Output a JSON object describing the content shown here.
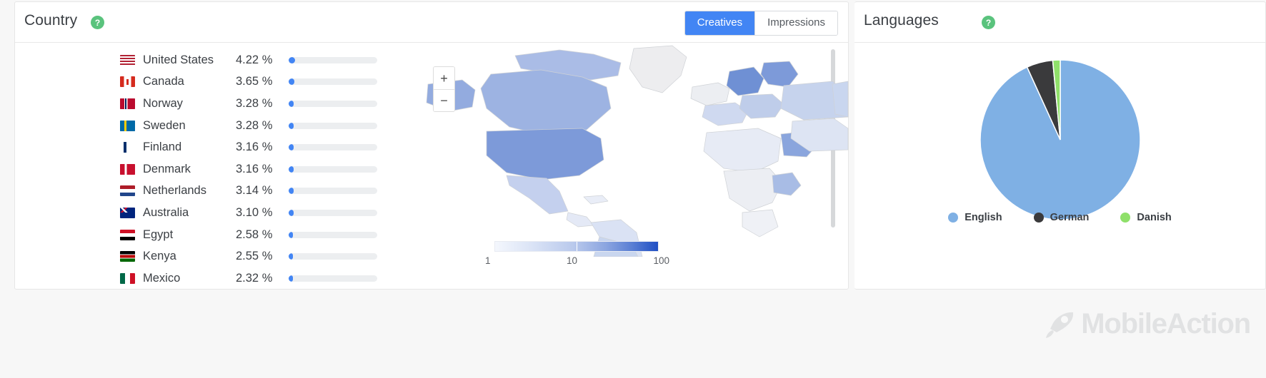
{
  "country_panel": {
    "title": "Country",
    "help_icon": "question-mark-icon",
    "help_label": "?",
    "toggle": {
      "options": [
        "Creatives",
        "Impressions"
      ],
      "selected": "Creatives"
    },
    "columns": [
      "flag",
      "country",
      "percent",
      "share_bar"
    ],
    "rows": [
      {
        "country": "United States",
        "percent": "4.22 %",
        "value": 4.22,
        "flag": "us"
      },
      {
        "country": "Canada",
        "percent": "3.65 %",
        "value": 3.65,
        "flag": "ca"
      },
      {
        "country": "Norway",
        "percent": "3.28 %",
        "value": 3.28,
        "flag": "no"
      },
      {
        "country": "Sweden",
        "percent": "3.28 %",
        "value": 3.28,
        "flag": "se"
      },
      {
        "country": "Finland",
        "percent": "3.16 %",
        "value": 3.16,
        "flag": "fi"
      },
      {
        "country": "Denmark",
        "percent": "3.16 %",
        "value": 3.16,
        "flag": "dk"
      },
      {
        "country": "Netherlands",
        "percent": "3.14 %",
        "value": 3.14,
        "flag": "nl"
      },
      {
        "country": "Australia",
        "percent": "3.10 %",
        "value": 3.1,
        "flag": "au"
      },
      {
        "country": "Egypt",
        "percent": "2.58 %",
        "value": 2.58,
        "flag": "eg"
      },
      {
        "country": "Kenya",
        "percent": "2.55 %",
        "value": 2.55,
        "flag": "ke"
      },
      {
        "country": "Mexico",
        "percent": "2.32 %",
        "value": 2.32,
        "flag": "mx"
      }
    ]
  },
  "map": {
    "zoom_in_label": "+",
    "zoom_out_label": "−",
    "legend": {
      "ticks": [
        "1",
        "10",
        "100"
      ],
      "low_color": "#f4f7fd",
      "high_color": "#1f4fc4"
    }
  },
  "languages_panel": {
    "title": "Languages",
    "help_icon": "question-mark-icon",
    "help_label": "?"
  },
  "chart_data": {
    "type": "pie",
    "title": "Languages",
    "categories": [
      "English",
      "German",
      "Danish"
    ],
    "values": [
      93.2,
      5.3,
      1.5
    ],
    "colors": [
      "#7fb0e4",
      "#3a3a3c",
      "#8fe06a"
    ],
    "legend_position": "bottom",
    "unit": "%"
  },
  "brand": {
    "name": "MobileAction",
    "icon": "rocket-icon"
  }
}
